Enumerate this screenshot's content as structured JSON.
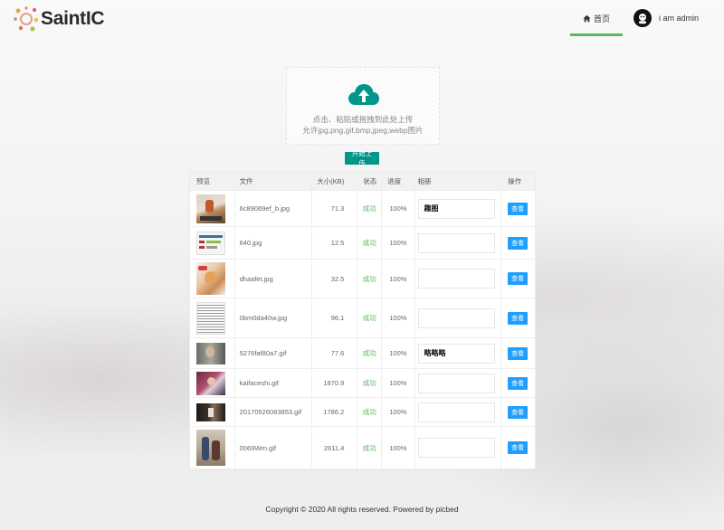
{
  "header": {
    "logo_text": "SaintIC",
    "nav_home": "首页",
    "user": "i am admin"
  },
  "upload": {
    "line1": "点击、粘贴或拖拽到此处上传",
    "line2": "允许jpg,png,gif,bmp,jpeg,webp图片",
    "button": "开始上传"
  },
  "table": {
    "headers": [
      "预览",
      "文件",
      "大小(KB)",
      "状态",
      "进度",
      "相册",
      "操作"
    ],
    "rows": [
      {
        "file": "6c89069ef_b.jpg",
        "size": "71.3",
        "status": "成功",
        "progress": "100%",
        "album": "趣图",
        "action": "查看"
      },
      {
        "file": "640.jpg",
        "size": "12.5",
        "status": "成功",
        "progress": "100%",
        "album": "",
        "action": "查看"
      },
      {
        "file": "dhaafet.jpg",
        "size": "32.5",
        "status": "成功",
        "progress": "100%",
        "album": "",
        "action": "查看"
      },
      {
        "file": "0bm0da40w.jpg",
        "size": "96.1",
        "status": "成功",
        "progress": "100%",
        "album": "",
        "action": "查看"
      },
      {
        "file": "5276faf80a7.gif",
        "size": "77.6",
        "status": "成功",
        "progress": "100%",
        "album": "略略略",
        "action": "查看"
      },
      {
        "file": "kaifaceshi.gif",
        "size": "1870.9",
        "status": "成功",
        "progress": "100%",
        "album": "",
        "action": "查看"
      },
      {
        "file": "20170526083853.gif",
        "size": "1786.2",
        "status": "成功",
        "progress": "100%",
        "album": "",
        "action": "查看"
      },
      {
        "file": "0069Wrn.gif",
        "size": "2611.4",
        "status": "成功",
        "progress": "100%",
        "album": "",
        "action": "查看"
      }
    ]
  },
  "footer": {
    "text": "Copyright © 2020 All rights reserved. Powered by ",
    "link": "picbed"
  },
  "colors": {
    "accent_green": "#5cb85c",
    "upload_button": "#009688",
    "view_button": "#1e9fff",
    "cloud_icon": "#009688"
  }
}
